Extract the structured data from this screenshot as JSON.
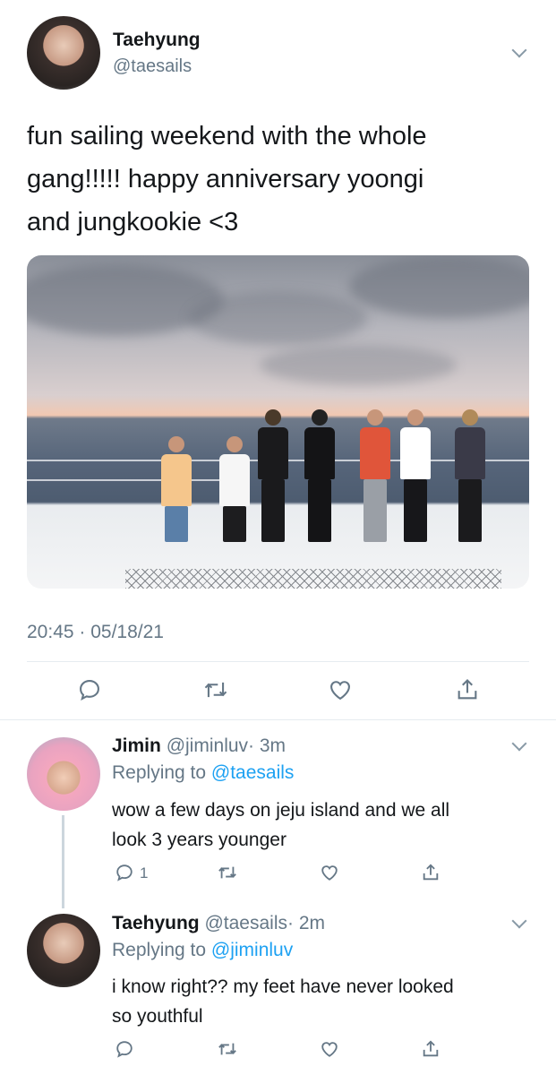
{
  "main_tweet": {
    "display_name": "Taehyung",
    "handle": "@taesails",
    "text_lines": [
      "fun sailing weekend with the whole",
      "gang!!!!! happy anniversary yoongi",
      "and jungkookie <3"
    ],
    "timestamp": "20:45 · 05/18/21"
  },
  "replies": [
    {
      "display_name": "Jimin",
      "handle": "@jiminluv",
      "age": "· 3m",
      "replying_prefix": "Replying to",
      "replying_to": "@taesails",
      "text_lines": [
        "wow a few days on jeju island and we all",
        "look 3 years younger"
      ],
      "reply_count": "1"
    },
    {
      "display_name": "Taehyung",
      "handle": "@taesails",
      "age": "· 2m",
      "replying_prefix": "Replying to",
      "replying_to": "@jiminluv",
      "text_lines": [
        "i know right?? my feet have never looked",
        "so youthful"
      ],
      "reply_count": ""
    }
  ],
  "icons": [
    "chevron-down-icon",
    "reply-icon",
    "retweet-icon",
    "like-icon",
    "share-icon"
  ],
  "colors": {
    "text": "#14171a",
    "muted": "#657786",
    "link": "#1da1f2",
    "icon": "#657786",
    "divider": "#e6ecf0"
  }
}
